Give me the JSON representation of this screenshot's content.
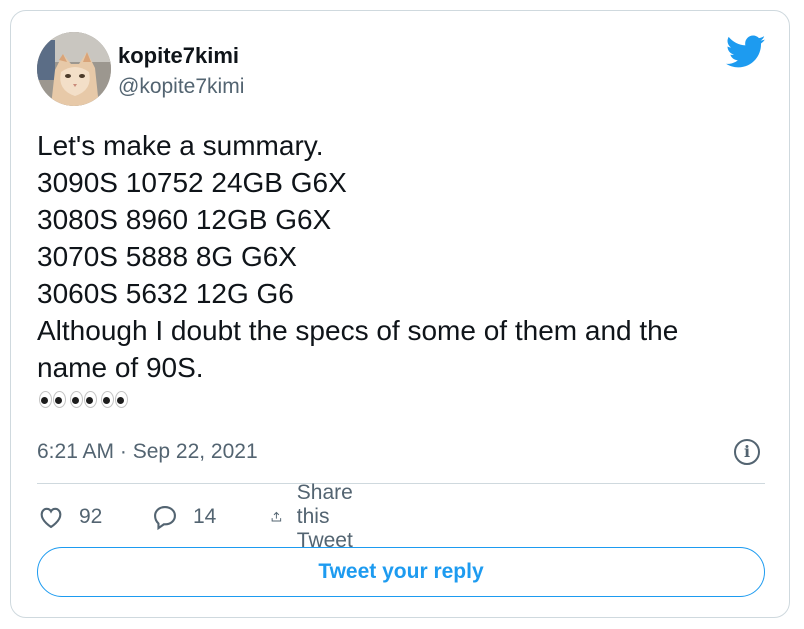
{
  "author": {
    "display_name": "kopite7kimi",
    "handle": "@kopite7kimi"
  },
  "icons": {
    "brand": "twitter-bird-icon",
    "info": "info-icon",
    "like": "heart-icon",
    "reply": "reply-icon",
    "share": "share-icon"
  },
  "tweet": {
    "lines": [
      "Let's make a summary.",
      "3090S 10752 24GB G6X",
      "3080S 8960 12GB G6X",
      "3070S 5888 8G G6X",
      "3060S 5632 12G G6",
      "Although I doubt the specs of some of them and the",
      "name of 90S."
    ],
    "emoji": [
      "👀",
      "👀",
      "👀"
    ],
    "timestamp": "6:21 AM · Sep 22, 2021"
  },
  "actions": {
    "likes": "92",
    "replies": "14",
    "share_label": "Share this Tweet"
  },
  "reply_button_label": "Tweet your reply",
  "colors": {
    "accent": "#1d9bf0",
    "text": "#0f1419",
    "muted": "#536471",
    "border": "#cfd9de"
  }
}
